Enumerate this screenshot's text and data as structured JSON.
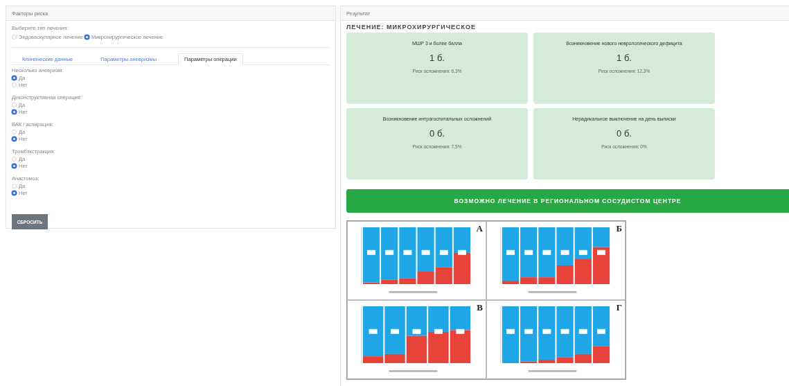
{
  "risk_factors": {
    "title": "Факторы риска",
    "treatment_prompt": "Выберите тип лечения:",
    "treatment_options": [
      {
        "label": "Эндоваскулярное лечение",
        "selected": false
      },
      {
        "label": "Микрохирургическое лечение",
        "selected": true
      }
    ],
    "tabs": [
      {
        "label": "Клинические данные",
        "selected": false
      },
      {
        "label": "Параметры аневризмы",
        "selected": false
      },
      {
        "label": "Параметры операции",
        "selected": true
      }
    ],
    "questions": [
      {
        "label": "Несколько аневризм:",
        "options": [
          {
            "label": "Да",
            "selected": true
          },
          {
            "label": "Нет",
            "selected": false
          }
        ]
      },
      {
        "label": "Деконструктивная операция:",
        "options": [
          {
            "label": "Да",
            "selected": false
          },
          {
            "label": "Нет",
            "selected": true
          }
        ]
      },
      {
        "label": "ВАК / аспирация:",
        "options": [
          {
            "label": "Да",
            "selected": false
          },
          {
            "label": "Нет",
            "selected": true
          }
        ]
      },
      {
        "label": "Тромбэкстракция:",
        "options": [
          {
            "label": "Да",
            "selected": false
          },
          {
            "label": "Нет",
            "selected": true
          }
        ]
      },
      {
        "label": "Анастомоз:",
        "options": [
          {
            "label": "Да",
            "selected": false
          },
          {
            "label": "Нет",
            "selected": true
          }
        ]
      }
    ],
    "reset_button": "СБРОСИТЬ"
  },
  "result": {
    "title": "Результат",
    "heading": "ЛЕЧЕНИЕ: МИКРОХИРУРГИЧЕСКОЕ",
    "cards": [
      {
        "title": "МШР 3 и более балла",
        "score": "1 б.",
        "risk": "Риск осложнения: 6,3%"
      },
      {
        "title": "Возникновение нового неврологического дефицита",
        "score": "1 б.",
        "risk": "Риск осложнения: 12,3%"
      },
      {
        "title": "Возникновение интрагоспитальных осложнений",
        "score": "0 б.",
        "risk": "Риск осложнения: 7,5%"
      },
      {
        "title": "Нерадикальное выключение на день выписки",
        "score": "0 б.",
        "risk": "Риск осложнения: 0%"
      }
    ],
    "banner": "ВОЗМОЖНО ЛЕЧЕНИЕ В РЕГИОНАЛЬНОМ СОСУДИСТОМ ЦЕНТРЕ",
    "figure_panels": [
      {
        "letter": "А"
      },
      {
        "letter": "Б"
      },
      {
        "letter": "В"
      },
      {
        "letter": "Г"
      }
    ]
  }
}
